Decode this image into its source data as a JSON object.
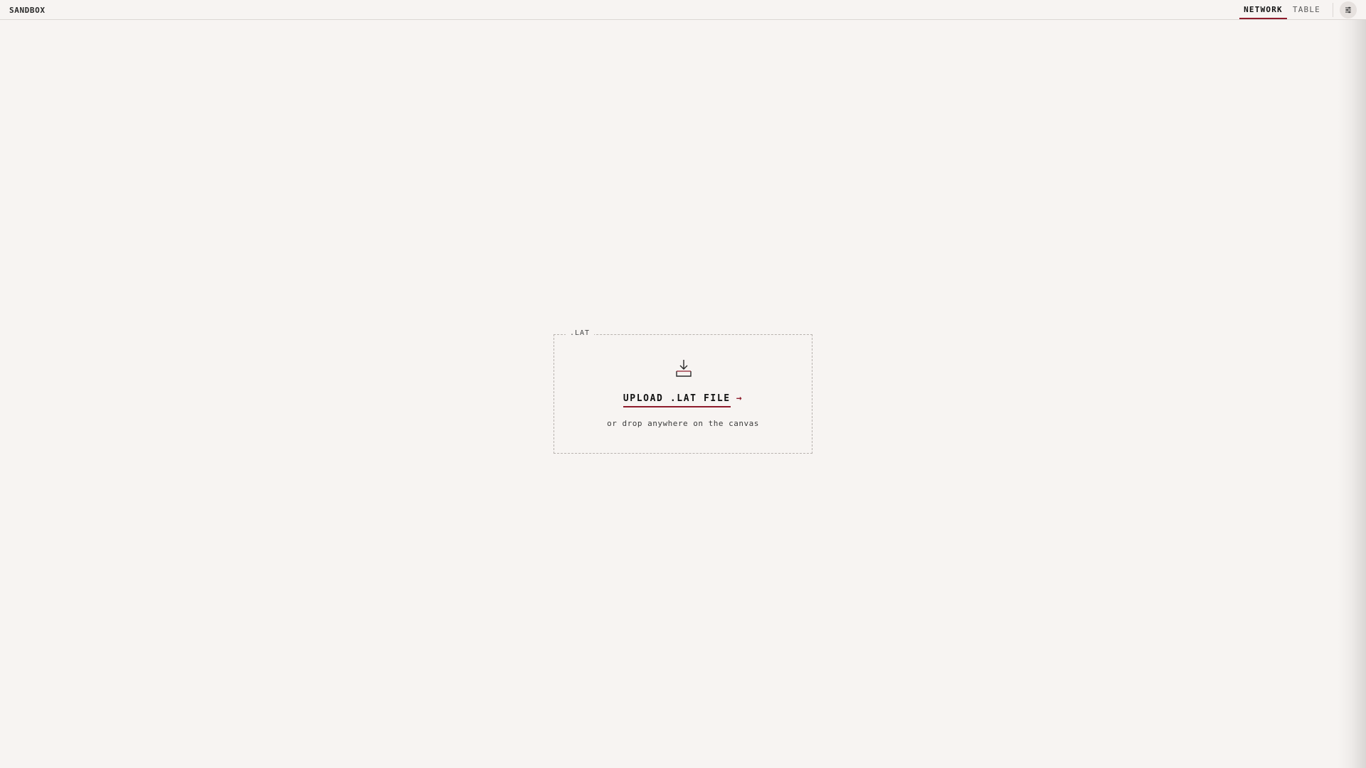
{
  "app": {
    "title": "SANDBOX"
  },
  "header": {
    "tabs": [
      {
        "label": "NETWORK",
        "active": true
      },
      {
        "label": "TABLE",
        "active": false
      }
    ],
    "settings_icon": "sliders-icon"
  },
  "upload": {
    "legend": ".LAT",
    "icon": "download-tray-icon",
    "button_label": "UPLOAD .LAT FILE",
    "arrow": "→",
    "hint": "or drop anywhere on the canvas"
  },
  "colors": {
    "background": "#f7f4f2",
    "accent": "#8e1c2c",
    "border": "#dcd7d4"
  }
}
